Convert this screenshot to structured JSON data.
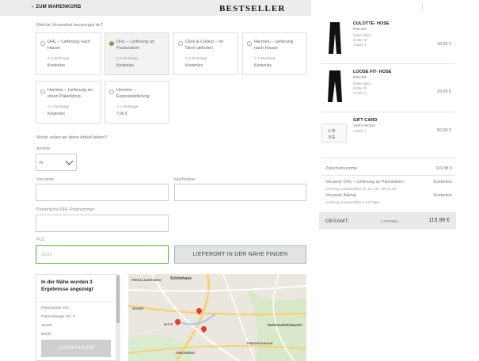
{
  "header": {
    "back_label": "ZUM WARENKORB",
    "logo": "BESTSELLER"
  },
  "shipping": {
    "question": "Welche Versandart bevorzugst du?",
    "options": [
      {
        "title": "DHL – Lieferung nach Hause",
        "days": "2-3 Werktage",
        "price": "Kostenlos",
        "selected": false
      },
      {
        "title": "DHL – Lieferung an Packstation",
        "days": "2-3 Werktage",
        "price": "Kostenlos",
        "selected": true
      },
      {
        "title": "Click & Collect – im Store abholen",
        "days": "2-3 Werktage",
        "price": "Kostenlos",
        "selected": false
      },
      {
        "title": "Hermes – Lieferung nach Hause",
        "days": "2-3 Werktage",
        "price": "Kostenlos",
        "selected": false
      },
      {
        "title": "Hermes – Lieferung an einen Paketshop",
        "days": "2-3 Werktage",
        "price": "Kostenlos",
        "selected": false
      },
      {
        "title": "Hermes – Expresslieferung",
        "days": "1-2 Werktage",
        "price": "7,95 €",
        "selected": false
      }
    ]
  },
  "address": {
    "question": "Wohin sollen wir deine Artikel liefern?",
    "salutation_label": "Anrede:",
    "salutation_value": "Fr.",
    "firstname_label": "Vorname:",
    "lastname_label": "Nachname:",
    "postnumber_label": "Persönliche DHL-Postnummer:",
    "zip_label": "PLZ:",
    "zip_value": "10115",
    "find_button": "LIEFERORT IN DER NÄHE FINDEN"
  },
  "results": {
    "heading": "In der Nähe wurden 3 Ergebnisse angezeigt",
    "lines": [
      "Packstation 104",
      "Rüdersberger Str. 8",
      "10435",
      "Berlin"
    ],
    "select_button": "AUSWÄHLEN"
  },
  "map": {
    "labels": [
      "Schönhaus",
      "Hohenschönhausen",
      "PRENZLAUER BERG",
      "MITTE",
      "KREUZBERG",
      "FRIEDRICHSHAIN",
      "MOABIT"
    ]
  },
  "cart": {
    "items": [
      {
        "name": "CULOTTE- HOSE",
        "brand": "PIECES",
        "attrs": [
          "Farbe: black",
          "Größe: M",
          "Anzahl: 1"
        ],
        "price": "39,99 €",
        "icon": "pants-icon"
      },
      {
        "name": "LOOSE FIT- HOSE",
        "brand": "PIECES",
        "attrs": [
          "Farbe: black",
          "Größe: M",
          "Anzahl: 1"
        ],
        "price": "29,99 €",
        "icon": "pants-icon"
      },
      {
        "name": "GIFT CARD",
        "brand": "VERO MODA",
        "attrs": [
          "Anzahl: 1"
        ],
        "price": "50,00 €",
        "icon": "gift-card-icon"
      }
    ],
    "subtotal_label": "Zwischensumme",
    "subtotal_value": "119,98 €",
    "shipping1_label": "Versand: DHL – Lieferung an Packstation",
    "shipping1_value": "Kostenlos",
    "shipping1_note": "Lieferung voraussichtlich: Di. 16. Juli – Mi 19. Juli",
    "shipping2_label": "Versand: Animal",
    "shipping2_value": "Kostenlos",
    "shipping2_note": "Lieferung voraussichtlich in 3-5 Tagen",
    "total_label": "GESAMT:",
    "total_count": "3 ARTIKEL",
    "total_value": "119,98 €"
  }
}
